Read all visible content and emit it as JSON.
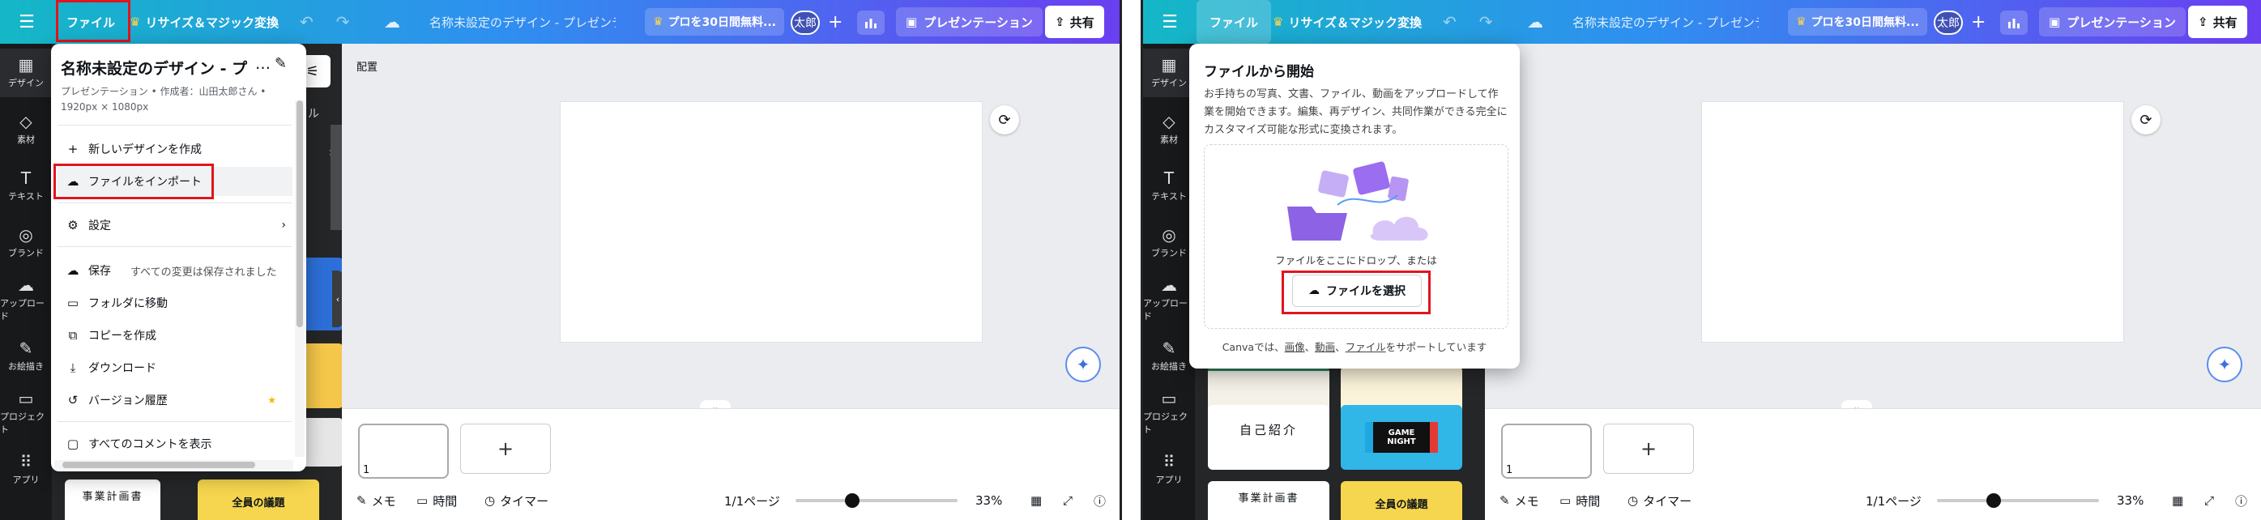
{
  "left": {
    "topbar": {
      "menu_icon": "☰",
      "file_label": "ファイル",
      "resize_label": "リサイズ＆マジック変換",
      "title": "名称未設定のデザイン - プレゼンテ",
      "pro_label": "プロを30日間無料...",
      "avatar": "太郎",
      "present_label": "プレゼンテーション",
      "share_label": "共有"
    },
    "rail": [
      {
        "icon": "▦",
        "label": "デザイン"
      },
      {
        "icon": "◇",
        "label": "素材"
      },
      {
        "icon": "T",
        "label": "テキスト"
      },
      {
        "icon": "◎",
        "label": "ブランド"
      },
      {
        "icon": "☁",
        "label": "アップロード"
      },
      {
        "icon": "✎",
        "label": "お絵描き"
      },
      {
        "icon": "▭",
        "label": "プロジェクト"
      },
      {
        "icon": "⠿",
        "label": "アプリ"
      }
    ],
    "panel": {
      "partial_label": "ル",
      "thumb_text_1": "事業計画書",
      "thumb_text_2": "全員の議題"
    },
    "work": {
      "haichi": "配置",
      "page_number": "1",
      "add_page": "+"
    },
    "file_menu": {
      "title": "名称未設定のデザイン - プレ",
      "dots": "…",
      "meta": "プレゼンテーション • 作成者：山田太郎さん • 1920px × 1080px",
      "items": [
        {
          "icon": "+",
          "label": "新しいデザインを作成"
        },
        {
          "icon": "☁",
          "label": "ファイルをインポート"
        },
        {
          "icon": "⚙",
          "label": "設定",
          "arrow": "›"
        },
        {
          "icon": "☁",
          "label": "保存",
          "sub": "すべての変更は保存されました"
        },
        {
          "icon": "▭",
          "label": "フォルダに移動"
        },
        {
          "icon": "⧉",
          "label": "コピーを作成"
        },
        {
          "icon": "⤓",
          "label": "ダウンロード"
        },
        {
          "icon": "↺",
          "label": "バージョン履歴",
          "badge": "★"
        },
        {
          "icon": "▢",
          "label": "すべてのコメントを表示"
        }
      ]
    },
    "footer": {
      "memo": "メモ",
      "time": "時間",
      "timer": "タイマー",
      "page": "1/1ページ",
      "zoom": "33%",
      "zoom_fraction": 0.35
    }
  },
  "right": {
    "topbar": {
      "menu_icon": "☰",
      "file_label": "ファイル",
      "resize_label": "リサイズ＆マジック変換",
      "title": "名称未設定のデザイン - プレゼンテ",
      "pro_label": "プロを30日間無料...",
      "avatar": "太郎",
      "present_label": "プレゼンテーション",
      "share_label": "共有"
    },
    "panel": {
      "thumb_text_1": "自己紹介",
      "thumb_text_2": "GAME NIGHT",
      "thumb_text_3": "事業計画書",
      "thumb_text_4": "全員の議題"
    },
    "start_panel": {
      "title": "ファイルから開始",
      "desc": "お手持ちの写真、文書、ファイル、動画をアップロードして作業を開始できます。編集、再デザイン、共同作業ができる完全にカスタマイズ可能な形式に変換されます。",
      "drop_text": "ファイルをここにドロップ、または",
      "select_label": "ファイルを選択",
      "support_prefix": "Canvaでは、",
      "support_image": "画像",
      "support_sep1": "、",
      "support_video": "動画",
      "support_sep2": "、",
      "support_file": "ファイル",
      "support_suffix": "をサポートしています"
    },
    "work": {
      "page_number": "1",
      "add_page": "+"
    },
    "footer": {
      "memo": "メモ",
      "time": "時間",
      "timer": "タイマー",
      "page": "1/1ページ",
      "zoom": "33%",
      "zoom_fraction": 0.35
    }
  }
}
